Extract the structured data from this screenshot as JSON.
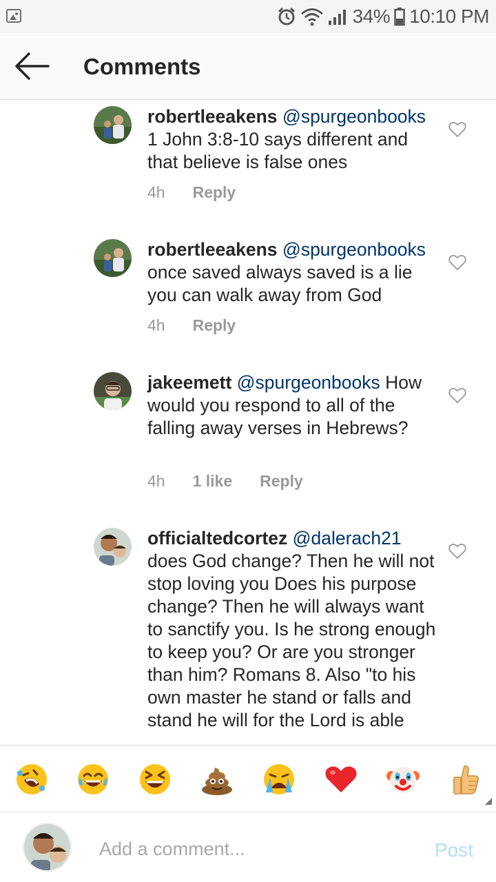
{
  "status_bar": {
    "icons": [
      "image-notification-icon",
      "alarm-icon",
      "wifi-icon",
      "signal-icon",
      "battery-icon"
    ],
    "battery": "34%",
    "time": "10:10 PM"
  },
  "header": {
    "back_icon": "arrow-left-icon",
    "title": "Comments"
  },
  "comments": [
    {
      "username": "robertleeakens",
      "mention": "@spurgeonbooks",
      "text": "1 John 3:8-10 says different and that believe is false ones",
      "time": "4h",
      "likes": "",
      "reply": "Reply"
    },
    {
      "username": "robertleeakens",
      "mention": "@spurgeonbooks",
      "text": "once saved always saved is a lie you can walk away from God",
      "time": "4h",
      "likes": "",
      "reply": "Reply"
    },
    {
      "username": "jakeemett",
      "mention": "@spurgeonbooks",
      "text": "How would you respond to all of the falling away verses in Hebrews?",
      "time": "4h",
      "likes": "1 like",
      "reply": "Reply"
    },
    {
      "username": "officialtedcortez",
      "mention": "@dalerach21",
      "text": "does God change? Then he will not stop loving you Does his purpose change? Then he will always want to sanctify you. Is he strong enough to keep you? Or are you stronger than him? Romans 8. Also \"to his own master he stand or falls and stand he will for the Lord is able",
      "time": "",
      "likes": "",
      "reply": ""
    }
  ],
  "emoji_bar": [
    "rofl-emoji",
    "joy-emoji",
    "laughing-emoji",
    "poop-emoji",
    "crying-emoji",
    "red-heart-emoji",
    "clown-emoji",
    "thumbs-up-emoji"
  ],
  "input": {
    "placeholder": "Add a comment...",
    "post_label": "Post"
  },
  "colors": {
    "mention": "#003569",
    "meta_gray": "#999999",
    "post_disabled": "#b2dffc",
    "divider": "#dbdbdb"
  }
}
